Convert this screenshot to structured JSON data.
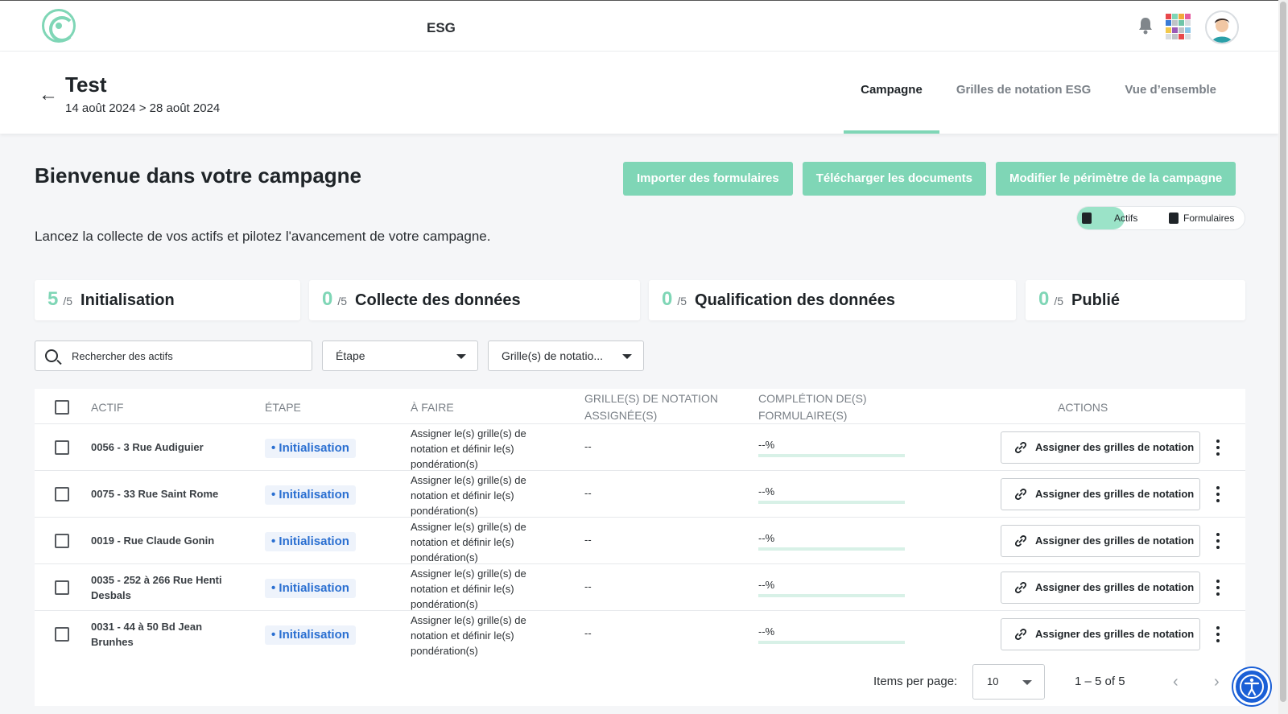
{
  "app": {
    "title": "ESG"
  },
  "colors": {
    "accent": "#7fd6b6",
    "badge_text": "#2a6fd1",
    "badge_bg": "#eef3fb",
    "a11y": "#1a5fd6"
  },
  "icons": {
    "notifications": "bell-icon",
    "apps": "apps-grid-icon",
    "user": "avatar",
    "back": "back-arrow-icon"
  },
  "campaign": {
    "title": "Test",
    "dates": "14 août 2024 > 28 août 2024"
  },
  "tabs": [
    {
      "label": "Campagne",
      "active": true
    },
    {
      "label": "Grilles de notation ESG",
      "active": false
    },
    {
      "label": "Vue d’ensemble",
      "active": false
    }
  ],
  "main": {
    "welcome": "Bienvenue dans votre campagne",
    "subtitle": "Lancez la collecte de vos actifs et pilotez l'avancement de votre campagne.",
    "buttons": {
      "import": "Importer des formulaires",
      "download": "Télécharger les documents",
      "modify": "Modifier le périmètre de la campagne"
    },
    "view_toggle": {
      "assets": "Actifs",
      "forms": "Formulaires",
      "selected": "Actifs"
    }
  },
  "stages": [
    {
      "count": "5",
      "total": "/5",
      "label": "Initialisation"
    },
    {
      "count": "0",
      "total": "/5",
      "label": "Collecte des données"
    },
    {
      "count": "0",
      "total": "/5",
      "label": "Qualification des données"
    },
    {
      "count": "0",
      "total": "/5",
      "label": "Publié"
    }
  ],
  "filters": {
    "search_placeholder": "Rechercher des actifs",
    "stage_select": "Étape",
    "grid_select": "Grille(s) de notatio..."
  },
  "table": {
    "headers": {
      "actif": "ACTIF",
      "etape": "ÉTAPE",
      "a_faire": "À FAIRE",
      "grilles": "GRILLE(S) DE NOTATION ASSIGNÉE(S)",
      "completion": "COMPLÉTION DE(S) FORMULAIRE(S)",
      "actions": "ACTIONS"
    },
    "rows": [
      {
        "actif": "0056 - 3 Rue Audiguier",
        "etape": "• Initialisation",
        "a_faire": "Assigner le(s) grille(s) de notation et définir le(s) pondération(s)",
        "grilles": "--",
        "completion": "--%",
        "progress": 0,
        "action": "Assigner des grilles de notation"
      },
      {
        "actif": "0075 - 33 Rue Saint Rome",
        "etape": "• Initialisation",
        "a_faire": "Assigner le(s) grille(s) de notation et définir le(s) pondération(s)",
        "grilles": "--",
        "completion": "--%",
        "progress": 0,
        "action": "Assigner des grilles de notation"
      },
      {
        "actif": "0019 - Rue Claude Gonin",
        "etape": "• Initialisation",
        "a_faire": "Assigner le(s) grille(s) de notation et définir le(s) pondération(s)",
        "grilles": "--",
        "completion": "--%",
        "progress": 0,
        "action": "Assigner des grilles de notation"
      },
      {
        "actif": "0035 - 252 à 266 Rue Henti Desbals",
        "etape": "• Initialisation",
        "a_faire": "Assigner le(s) grille(s) de notation et définir le(s) pondération(s)",
        "grilles": "--",
        "completion": "--%",
        "progress": 0,
        "action": "Assigner des grilles de notation"
      },
      {
        "actif": "0031 - 44 à 50 Bd Jean Brunhes",
        "etape": "• Initialisation",
        "a_faire": "Assigner le(s) grille(s) de notation et définir le(s) pondération(s)",
        "grilles": "--",
        "completion": "--%",
        "progress": 0,
        "action": "Assigner des grilles de notation"
      }
    ]
  },
  "pagination": {
    "items_per_page_label": "Items per page:",
    "items_per_page": "10",
    "range": "1 – 5 of 5",
    "prev": "‹",
    "next": "›"
  }
}
